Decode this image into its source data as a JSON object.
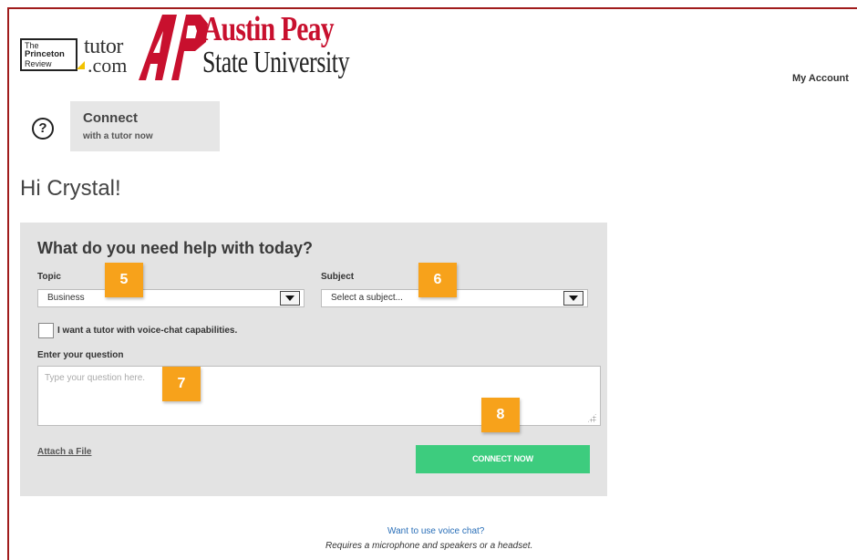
{
  "header": {
    "tpr_logo": {
      "line1": "The",
      "line2": "Princeton",
      "line3": "Review"
    },
    "tutor_logo": {
      "word1": "tutor",
      "word2": ".com"
    },
    "university_logo": {
      "mark": "AP",
      "line1": "Austin Peay",
      "line2": "State University"
    },
    "my_account_label": "My Account"
  },
  "connect_tab": {
    "help_icon": "help-circle-icon",
    "help_glyph": "?",
    "title": "Connect",
    "subtitle": "with a tutor now"
  },
  "greeting": "Hi Crystal!",
  "form": {
    "title": "What do you need help with today?",
    "topic": {
      "label": "Topic",
      "value": "Business"
    },
    "subject": {
      "label": "Subject",
      "value": "Select a subject..."
    },
    "voice_checkbox": {
      "label": "I want a tutor with voice-chat capabilities.",
      "checked": false
    },
    "question": {
      "label": "Enter your question",
      "placeholder": "Type your question here."
    },
    "attach_label": "Attach a File",
    "connect_label": "CONNECT NOW"
  },
  "badges": [
    "5",
    "6",
    "7",
    "8"
  ],
  "footer": {
    "voice_link": "Want to use voice chat?",
    "voice_note": "Requires a microphone and speakers or a headset."
  },
  "colors": {
    "brand_red": "#c8102e",
    "connect_green": "#3dcc7e",
    "badge_orange": "#f7a21b",
    "link_blue": "#2a6fb8"
  }
}
